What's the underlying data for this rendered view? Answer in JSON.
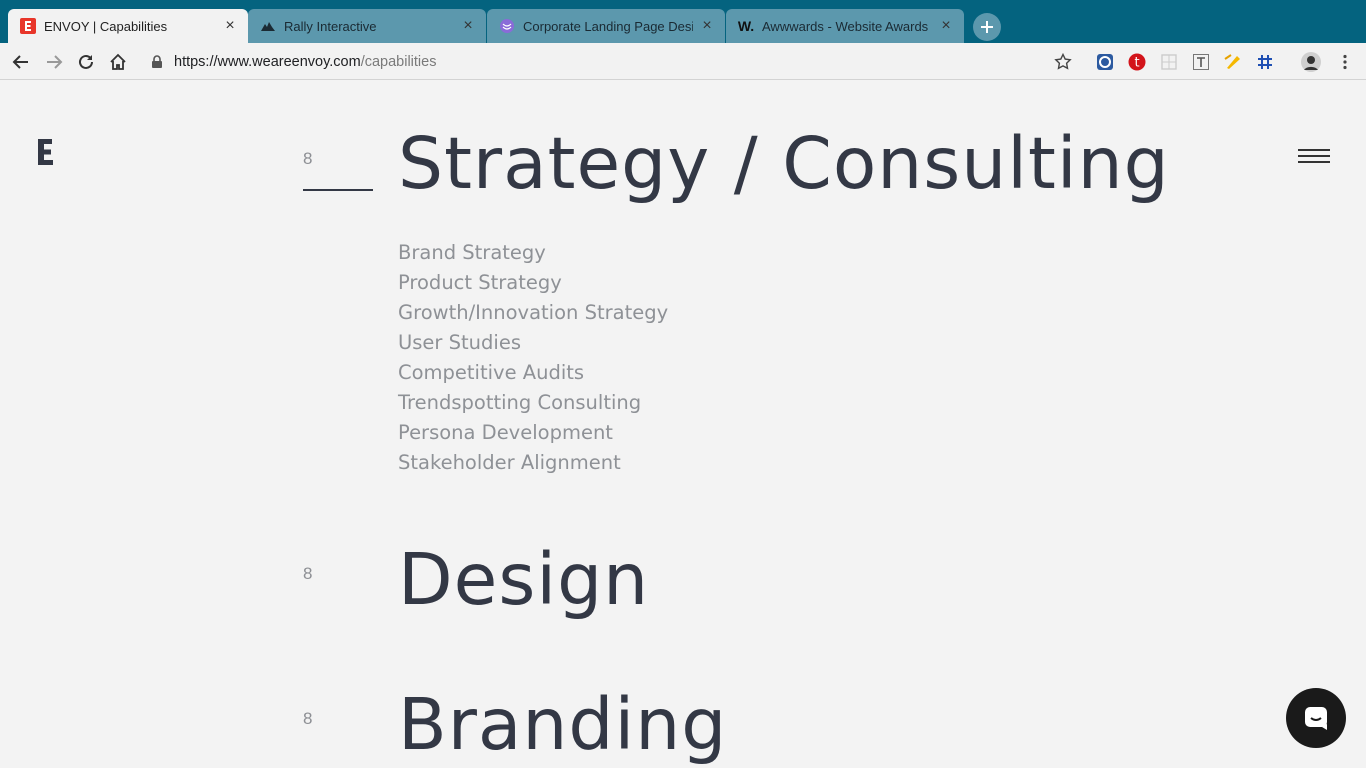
{
  "browser": {
    "tabs": [
      {
        "title": "ENVOY | Capabilities",
        "favicon": "envoy-e-icon",
        "active": true
      },
      {
        "title": "Rally Interactive",
        "favicon": "rally-icon",
        "active": false
      },
      {
        "title": "Corporate Landing Page Desig",
        "favicon": "dribbble-icon",
        "active": false
      },
      {
        "title": "Awwwards - Website Awards -",
        "favicon": "awwwards-w-icon",
        "active": false
      }
    ],
    "url": {
      "host": "https://www.weareenvoy.com",
      "path": "/capabilities"
    }
  },
  "page": {
    "sections": [
      {
        "number": "8",
        "title": "Strategy / Consulting",
        "items": [
          "Brand Strategy",
          "Product Strategy",
          "Growth/Innovation Strategy",
          "User Studies",
          "Competitive Audits",
          "Trendspotting Consulting",
          "Persona Development",
          "Stakeholder Alignment"
        ]
      },
      {
        "number": "8",
        "title": "Design"
      },
      {
        "number": "8",
        "title": "Branding"
      }
    ]
  },
  "colors": {
    "tabstrip": "#04637f",
    "heading": "#333845",
    "muted": "#8e9196",
    "background": "#f3f3f3"
  }
}
